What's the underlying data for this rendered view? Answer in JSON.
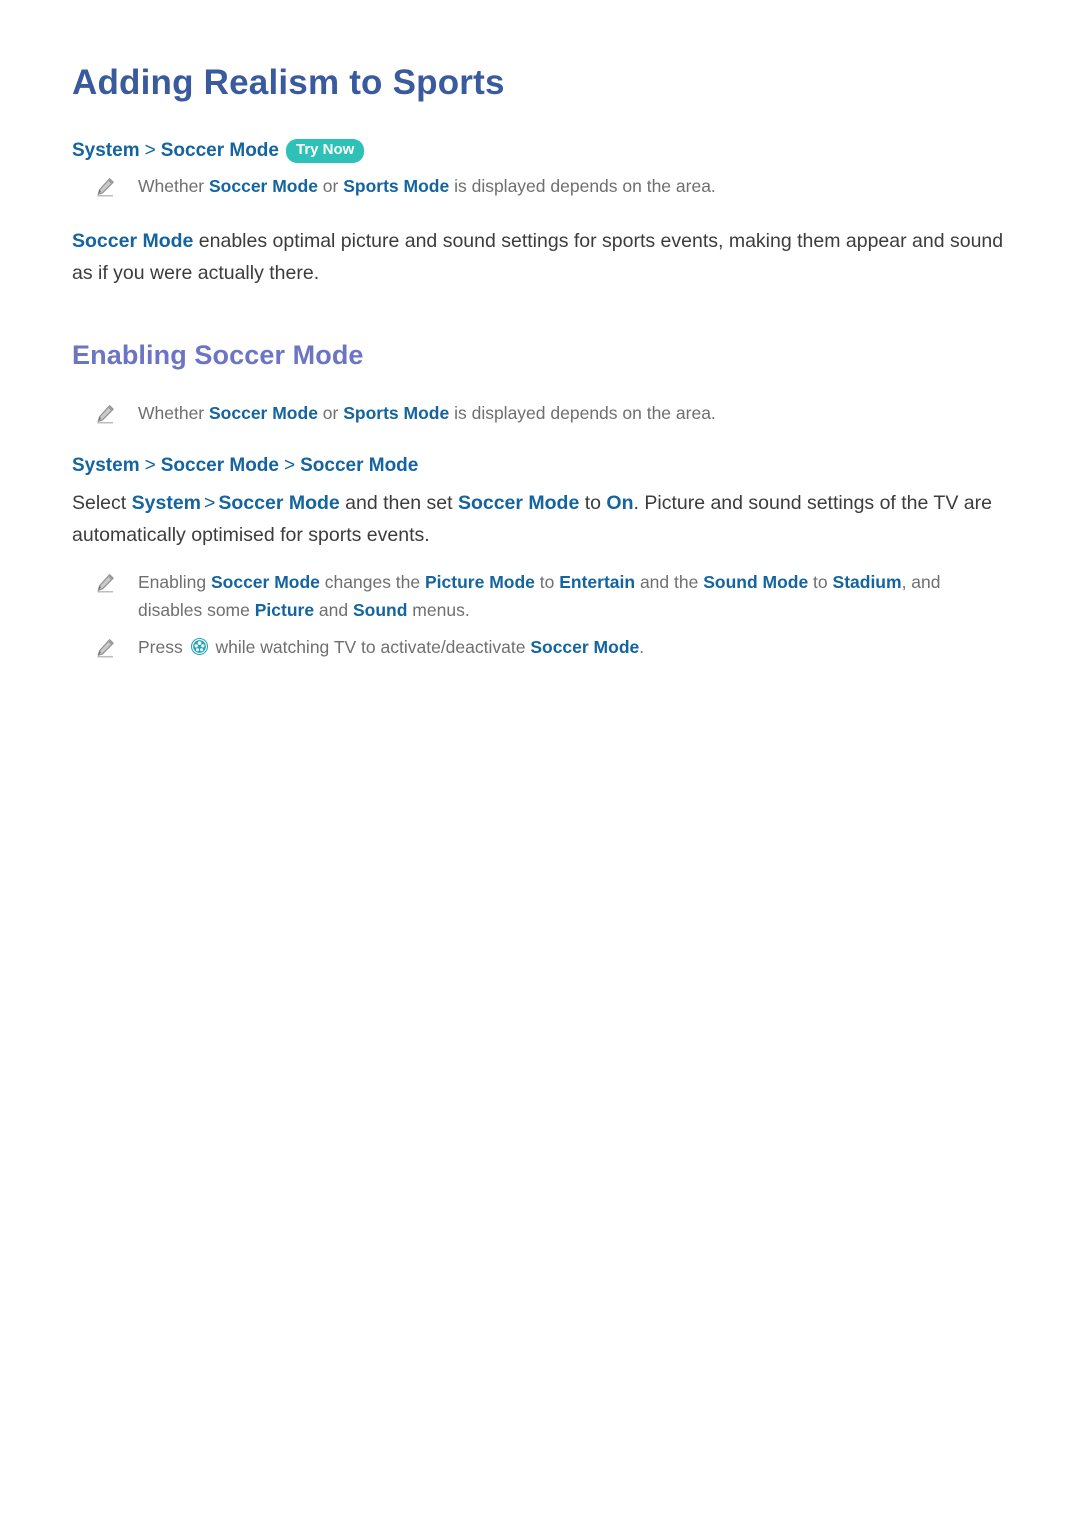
{
  "document": {
    "title": "Adding Realism to Sports",
    "section_title": "Enabling Soccer Mode"
  },
  "colors": {
    "title": "#3a5a9e",
    "section_title": "#6b75c4",
    "link": "#1464a0",
    "badge_background": "#2ec1b8",
    "badge_text": "#ffffff",
    "body_text": "#3c3c3c",
    "note_text": "#6f6f6f",
    "pencil_icon": "#9a9a9a",
    "ball_icon": "#1e8fa8"
  },
  "breadcrumb_top": {
    "items": [
      "System",
      "Soccer Mode"
    ],
    "separator": ">",
    "badge": "Try Now"
  },
  "note_1": {
    "icon": "pencil-icon",
    "segments": [
      {
        "text": "Whether ",
        "style": "plain"
      },
      {
        "text": "Soccer Mode",
        "style": "link"
      },
      {
        "text": " or ",
        "style": "plain"
      },
      {
        "text": "Sports Mode",
        "style": "link"
      },
      {
        "text": " is displayed depends on the area.",
        "style": "plain"
      }
    ]
  },
  "intro_paragraph": {
    "segments": [
      {
        "text": "Soccer Mode",
        "style": "link"
      },
      {
        "text": " enables optimal picture and sound settings for sports events, making them appear and sound as if you were actually there.",
        "style": "plain"
      }
    ]
  },
  "note_2": {
    "icon": "pencil-icon",
    "segments": [
      {
        "text": "Whether ",
        "style": "plain"
      },
      {
        "text": "Soccer Mode",
        "style": "link"
      },
      {
        "text": " or ",
        "style": "plain"
      },
      {
        "text": "Sports Mode",
        "style": "link"
      },
      {
        "text": " is displayed depends on the area.",
        "style": "plain"
      }
    ]
  },
  "breadcrumb_section": {
    "items": [
      "System",
      "Soccer Mode",
      "Soccer Mode"
    ],
    "separator": ">"
  },
  "select_paragraph": {
    "segments": [
      {
        "text": "Select ",
        "style": "plain"
      },
      {
        "text": "System",
        "style": "link"
      },
      {
        "text": ">",
        "style": "separator"
      },
      {
        "text": "Soccer Mode",
        "style": "link"
      },
      {
        "text": " and then set ",
        "style": "plain"
      },
      {
        "text": "Soccer Mode",
        "style": "link"
      },
      {
        "text": " to ",
        "style": "plain"
      },
      {
        "text": "On",
        "style": "link"
      },
      {
        "text": ". Picture and sound settings of the TV are automatically optimised for sports events.",
        "style": "plain"
      }
    ]
  },
  "note_3": {
    "icon": "pencil-icon",
    "segments": [
      {
        "text": "Enabling ",
        "style": "plain"
      },
      {
        "text": "Soccer Mode",
        "style": "link"
      },
      {
        "text": " changes the ",
        "style": "plain"
      },
      {
        "text": "Picture Mode",
        "style": "link"
      },
      {
        "text": " to ",
        "style": "plain"
      },
      {
        "text": "Entertain",
        "style": "link"
      },
      {
        "text": " and the ",
        "style": "plain"
      },
      {
        "text": "Sound Mode",
        "style": "link"
      },
      {
        "text": " to ",
        "style": "plain"
      },
      {
        "text": "Stadium",
        "style": "link"
      },
      {
        "text": ", and disables some ",
        "style": "plain"
      },
      {
        "text": "Picture",
        "style": "link"
      },
      {
        "text": " and ",
        "style": "plain"
      },
      {
        "text": "Sound",
        "style": "link"
      },
      {
        "text": " menus.",
        "style": "plain"
      }
    ]
  },
  "note_4": {
    "icon": "pencil-icon",
    "inline_icon": "soccer-ball-icon",
    "segments": [
      {
        "text": "Press ",
        "style": "plain"
      },
      {
        "text": "[soccer-ball-icon]",
        "style": "icon"
      },
      {
        "text": " while watching TV to activate/deactivate ",
        "style": "plain"
      },
      {
        "text": "Soccer Mode",
        "style": "link"
      },
      {
        "text": ".",
        "style": "plain"
      }
    ]
  },
  "text": {
    "title": "Adding Realism to Sports",
    "section_title": "Enabling Soccer Mode",
    "crumb_system": "System",
    "crumb_soccer_mode": "Soccer Mode",
    "crumb_soccer_mode_2": "Soccer Mode",
    "crumb_sep": ">",
    "try_now": "Try Now",
    "note1_a": "Whether ",
    "note1_b": "Soccer Mode",
    "note1_c": " or ",
    "note1_d": "Sports Mode",
    "note1_e": " is displayed depends on the area.",
    "intro_a": "Soccer Mode",
    "intro_b": " enables optimal picture and sound settings for sports events, making them appear and sound as if you were actually there.",
    "note2_a": "Whether ",
    "note2_b": "Soccer Mode",
    "note2_c": " or ",
    "note2_d": "Sports Mode",
    "note2_e": " is displayed depends on the area.",
    "sel_a": "Select ",
    "sel_b": "System",
    "sel_sep": ">",
    "sel_c": "Soccer Mode",
    "sel_d": " and then set ",
    "sel_e": "Soccer Mode",
    "sel_f": " to ",
    "sel_g": "On",
    "sel_h": ". Picture and sound settings of the TV are automatically optimised for sports events.",
    "note3_a": "Enabling ",
    "note3_b": "Soccer Mode",
    "note3_c": " changes the ",
    "note3_d": "Picture Mode",
    "note3_e": " to ",
    "note3_f": "Entertain",
    "note3_g": " and the ",
    "note3_h": "Sound Mode",
    "note3_i": " to ",
    "note3_j": "Stadium",
    "note3_k": ", and disables some ",
    "note3_l": "Picture",
    "note3_m": " and ",
    "note3_n": "Sound",
    "note3_o": " menus.",
    "note4_a": "Press ",
    "note4_b": " while watching TV to activate/deactivate ",
    "note4_c": "Soccer Mode",
    "note4_d": "."
  }
}
